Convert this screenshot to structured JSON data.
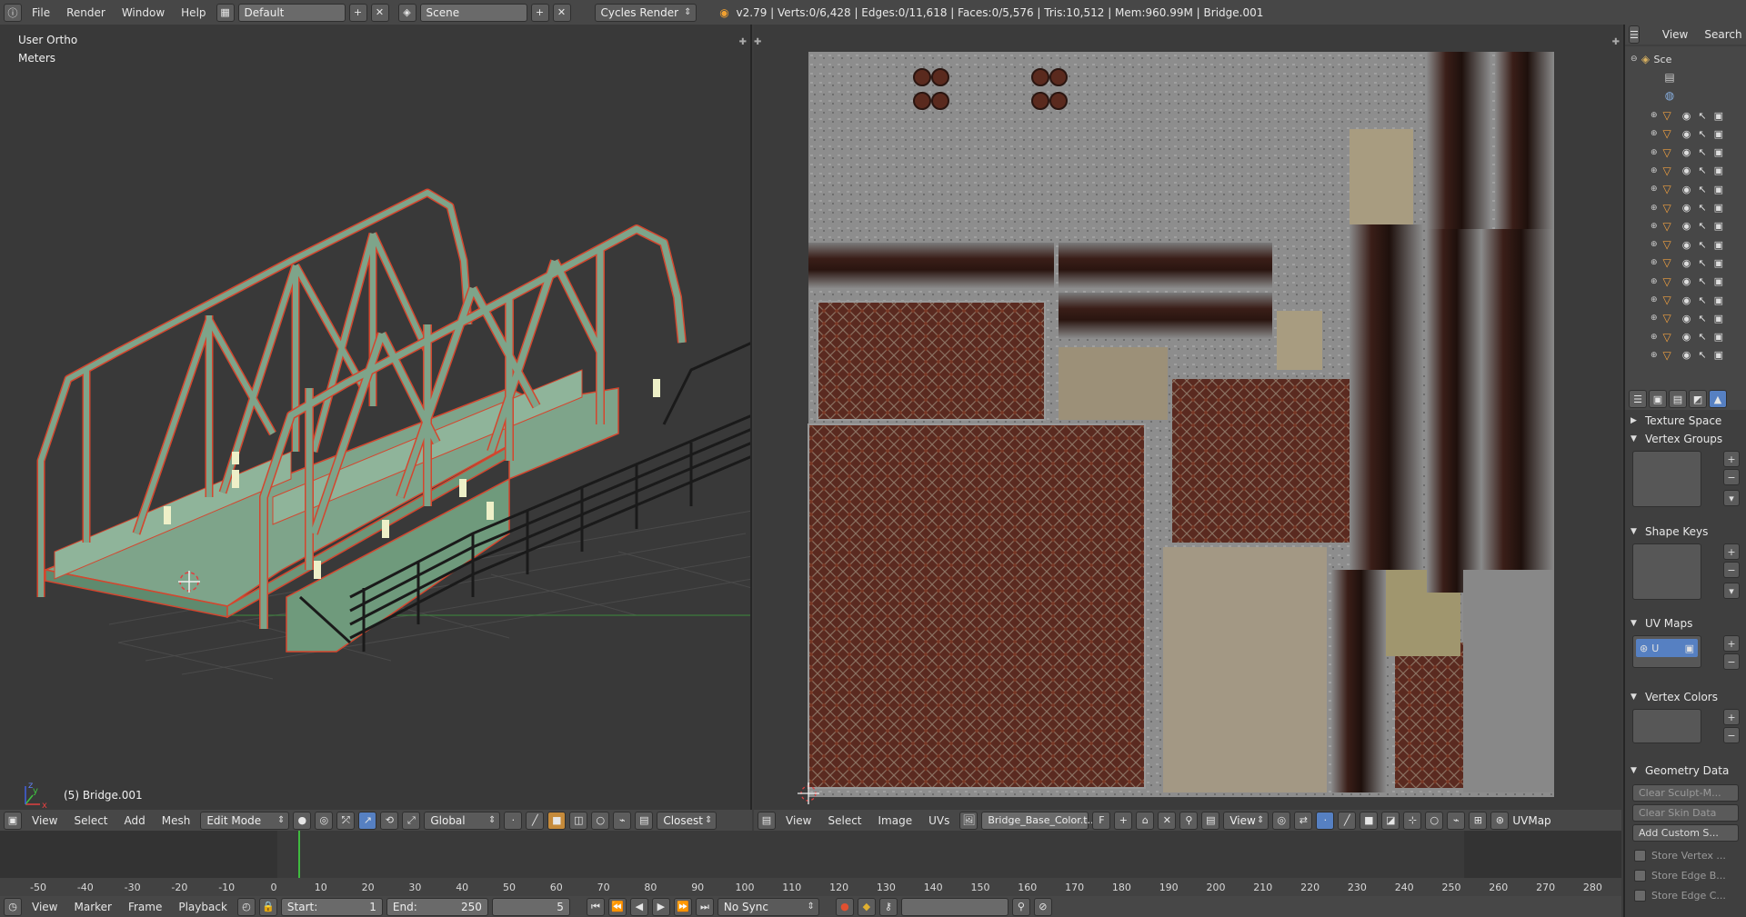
{
  "info_header": {
    "menus": [
      "File",
      "Render",
      "Window",
      "Help"
    ],
    "layout": "Default",
    "scene": "Scene",
    "engine": "Cycles Render",
    "stats": "v2.79 | Verts:0/6,428 | Edges:0/11,618 | Faces:0/5,576 | Tris:10,512 | Mem:960.99M | Bridge.001"
  },
  "viewport": {
    "view_name": "User Ortho",
    "units": "Meters",
    "object_label": "(5) Bridge.001",
    "menus": [
      "View",
      "Select",
      "Add",
      "Mesh"
    ],
    "mode": "Edit Mode",
    "orientation": "Global",
    "snap_target": "Closest",
    "axis_x": "x",
    "axis_y": "y",
    "axis_z": "z"
  },
  "uv_editor": {
    "menus": [
      "View",
      "Select",
      "Image",
      "UVs"
    ],
    "image_name": "Bridge_Base_Color.t...",
    "fake_user": "F",
    "view_menu": "View",
    "uv_map": "UVMap"
  },
  "outliner": {
    "menus": [
      "View",
      "Search"
    ],
    "scene_label": "Sce",
    "rows": 14
  },
  "properties": {
    "panels": {
      "texture_space": "Texture Space",
      "vertex_groups": "Vertex Groups",
      "shape_keys": "Shape Keys",
      "uv_maps": "UV Maps",
      "vertex_colors": "Vertex Colors",
      "geometry_data": "Geometry Data"
    },
    "uv_map_item": "U",
    "buttons": {
      "clear_sculpt": "Clear Sculpt-M...",
      "clear_skin": "Clear Skin Data",
      "add_custom": "Add Custom S..."
    },
    "checkboxes": [
      "Store Vertex ...",
      "Store Edge B...",
      "Store Edge C..."
    ]
  },
  "timeline": {
    "menus": [
      "View",
      "Marker",
      "Frame",
      "Playback"
    ],
    "start_label": "Start:",
    "start_value": "1",
    "end_label": "End:",
    "end_value": "250",
    "current_frame": "5",
    "sync": "No Sync",
    "ruler_ticks": [
      "-50",
      "-40",
      "-30",
      "-20",
      "-10",
      "0",
      "10",
      "20",
      "30",
      "40",
      "50",
      "60",
      "70",
      "80",
      "90",
      "100",
      "110",
      "120",
      "130",
      "140",
      "150",
      "160",
      "170",
      "180",
      "190",
      "200",
      "210",
      "220",
      "230",
      "240",
      "250",
      "260",
      "270",
      "280"
    ]
  },
  "colors": {
    "bridge_face": "#7ea48a",
    "bridge_edge": "#d4462e",
    "rust": "#6e2d22",
    "steel": "#8a8a8a",
    "current_frame_line": "#3fba3f"
  }
}
